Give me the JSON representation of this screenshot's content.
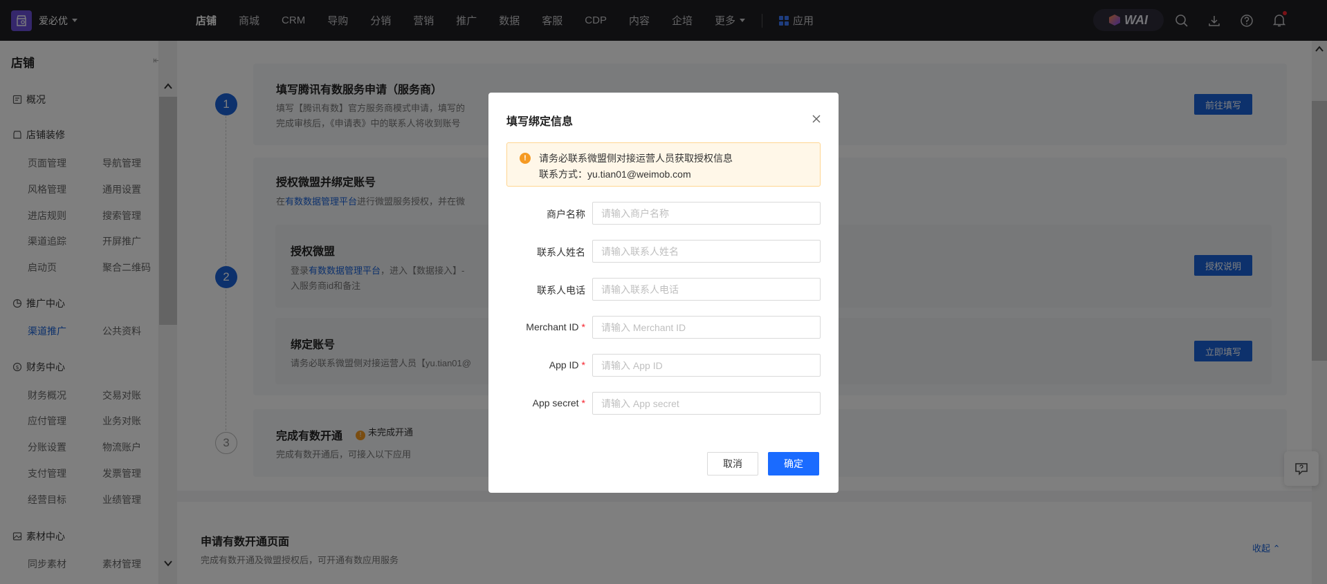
{
  "brand": {
    "name": "爱必优"
  },
  "nav": {
    "items": [
      "店铺",
      "商城",
      "CRM",
      "导购",
      "分销",
      "营销",
      "推广",
      "数据",
      "客服",
      "CDP",
      "内容",
      "企培",
      "更多"
    ],
    "apps_label": "应用",
    "wai_label": "WAI"
  },
  "sidebar": {
    "title": "店铺",
    "groups": [
      {
        "label": "概况",
        "icon": "overview-icon"
      },
      {
        "label": "店铺装修",
        "icon": "decor-icon",
        "items": [
          "页面管理",
          "导航管理",
          "风格管理",
          "通用设置",
          "进店规则",
          "搜索管理",
          "渠道追踪",
          "开屏推广",
          "启动页",
          "聚合二维码"
        ]
      },
      {
        "label": "推广中心",
        "icon": "promo-icon",
        "items": [
          "渠道推广",
          "公共资料"
        ],
        "active": "渠道推广"
      },
      {
        "label": "财务中心",
        "icon": "finance-icon",
        "items": [
          "财务概况",
          "交易对账",
          "应付管理",
          "业务对账",
          "分账设置",
          "物流账户",
          "支付管理",
          "发票管理",
          "经营目标",
          "业绩管理"
        ]
      },
      {
        "label": "素材中心",
        "icon": "material-icon",
        "items": [
          "同步素材",
          "素材管理"
        ]
      }
    ]
  },
  "main": {
    "step1": {
      "num": "1",
      "title": "填写腾讯有数服务申请（服务商）",
      "desc1": "填写【腾讯有数】官方服务商模式申请，填写的",
      "desc2": "完成审核后，《申请表》中的联系人将收到账号",
      "button": "前往填写"
    },
    "step2": {
      "num": "2",
      "title": "授权微盟并绑定账号",
      "desc_prefix": "在",
      "desc_link": "有数数据管理平台",
      "desc_suffix": "进行微盟服务授权，并在微",
      "sub1": {
        "title": "授权微盟",
        "desc_prefix": "登录",
        "desc_link": "有数数据管理平台",
        "desc_suffix": "，进入【数据接入】-",
        "desc2": "入服务商id和备注",
        "button": "授权说明"
      },
      "sub2": {
        "title": "绑定账号",
        "desc": "请务必联系微盟侧对接运营人员【yu.tian01@",
        "button": "立即填写"
      }
    },
    "step3": {
      "num": "3",
      "title": "完成有数开通",
      "status": "未完成开通",
      "desc": "完成有数开通后，可接入以下应用"
    },
    "section": {
      "title": "申请有数开通页面",
      "desc": "完成有数开通及微盟授权后，可开通有数应用服务",
      "collapse": "收起"
    }
  },
  "modal": {
    "title": "填写绑定信息",
    "alert_line1": "请务必联系微盟侧对接运营人员获取授权信息",
    "alert_line2": "联系方式：yu.tian01@weimob.com",
    "fields": [
      {
        "label": "商户名称",
        "placeholder": "请输入商户名称",
        "required": false,
        "value": ""
      },
      {
        "label": "联系人姓名",
        "placeholder": "请输入联系人姓名",
        "required": false,
        "value": ""
      },
      {
        "label": "联系人电话",
        "placeholder": "请输入联系人电话",
        "required": false,
        "value": ""
      },
      {
        "label": "Merchant ID",
        "placeholder": "请输入 Merchant ID",
        "required": true,
        "value": ""
      },
      {
        "label": "App ID",
        "placeholder": "请输入 App ID",
        "required": true,
        "value": ""
      },
      {
        "label": "App secret",
        "placeholder": "请输入 App secret",
        "required": true,
        "value": ""
      }
    ],
    "cancel_label": "取消",
    "ok_label": "确定"
  },
  "colors": {
    "primary": "#1a63d8",
    "topbar": "#1f1f22",
    "warning": "#f59a23"
  }
}
